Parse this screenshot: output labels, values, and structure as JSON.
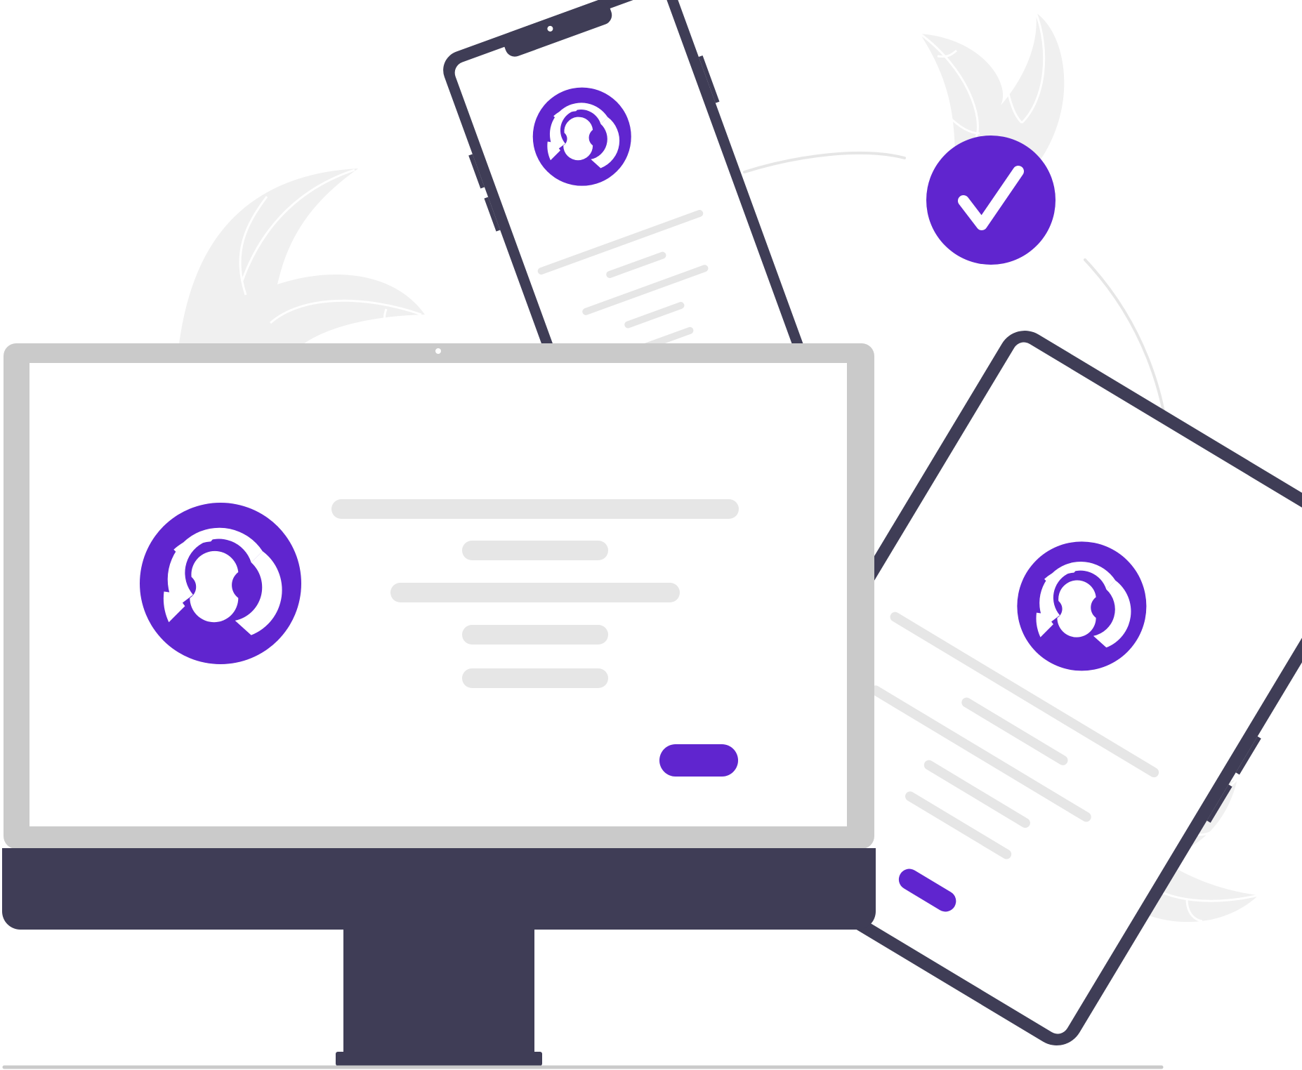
{
  "scene": {
    "description_free": true
  },
  "colors": {
    "accent": "#6025cf",
    "device_dark": "#3f3d56",
    "monitor_bezel": "#cacaca",
    "placeholder_line": "#e6e6e6",
    "leaf": "#f0f0f0",
    "floor": "#cacaca",
    "screen": "#ffffff"
  },
  "icons": {
    "logo": "eye-logo-icon",
    "check": "checkmark-icon"
  },
  "monitor": {
    "logo": "eye-logo-icon",
    "text_lines": 5,
    "action_button": "primary-button"
  },
  "phone": {
    "logo": "eye-logo-icon",
    "text_lines": 5
  },
  "tablet": {
    "logo": "eye-logo-icon",
    "text_lines": 5,
    "action_button": "primary-button"
  },
  "badge": {
    "icon": "checkmark-icon"
  }
}
